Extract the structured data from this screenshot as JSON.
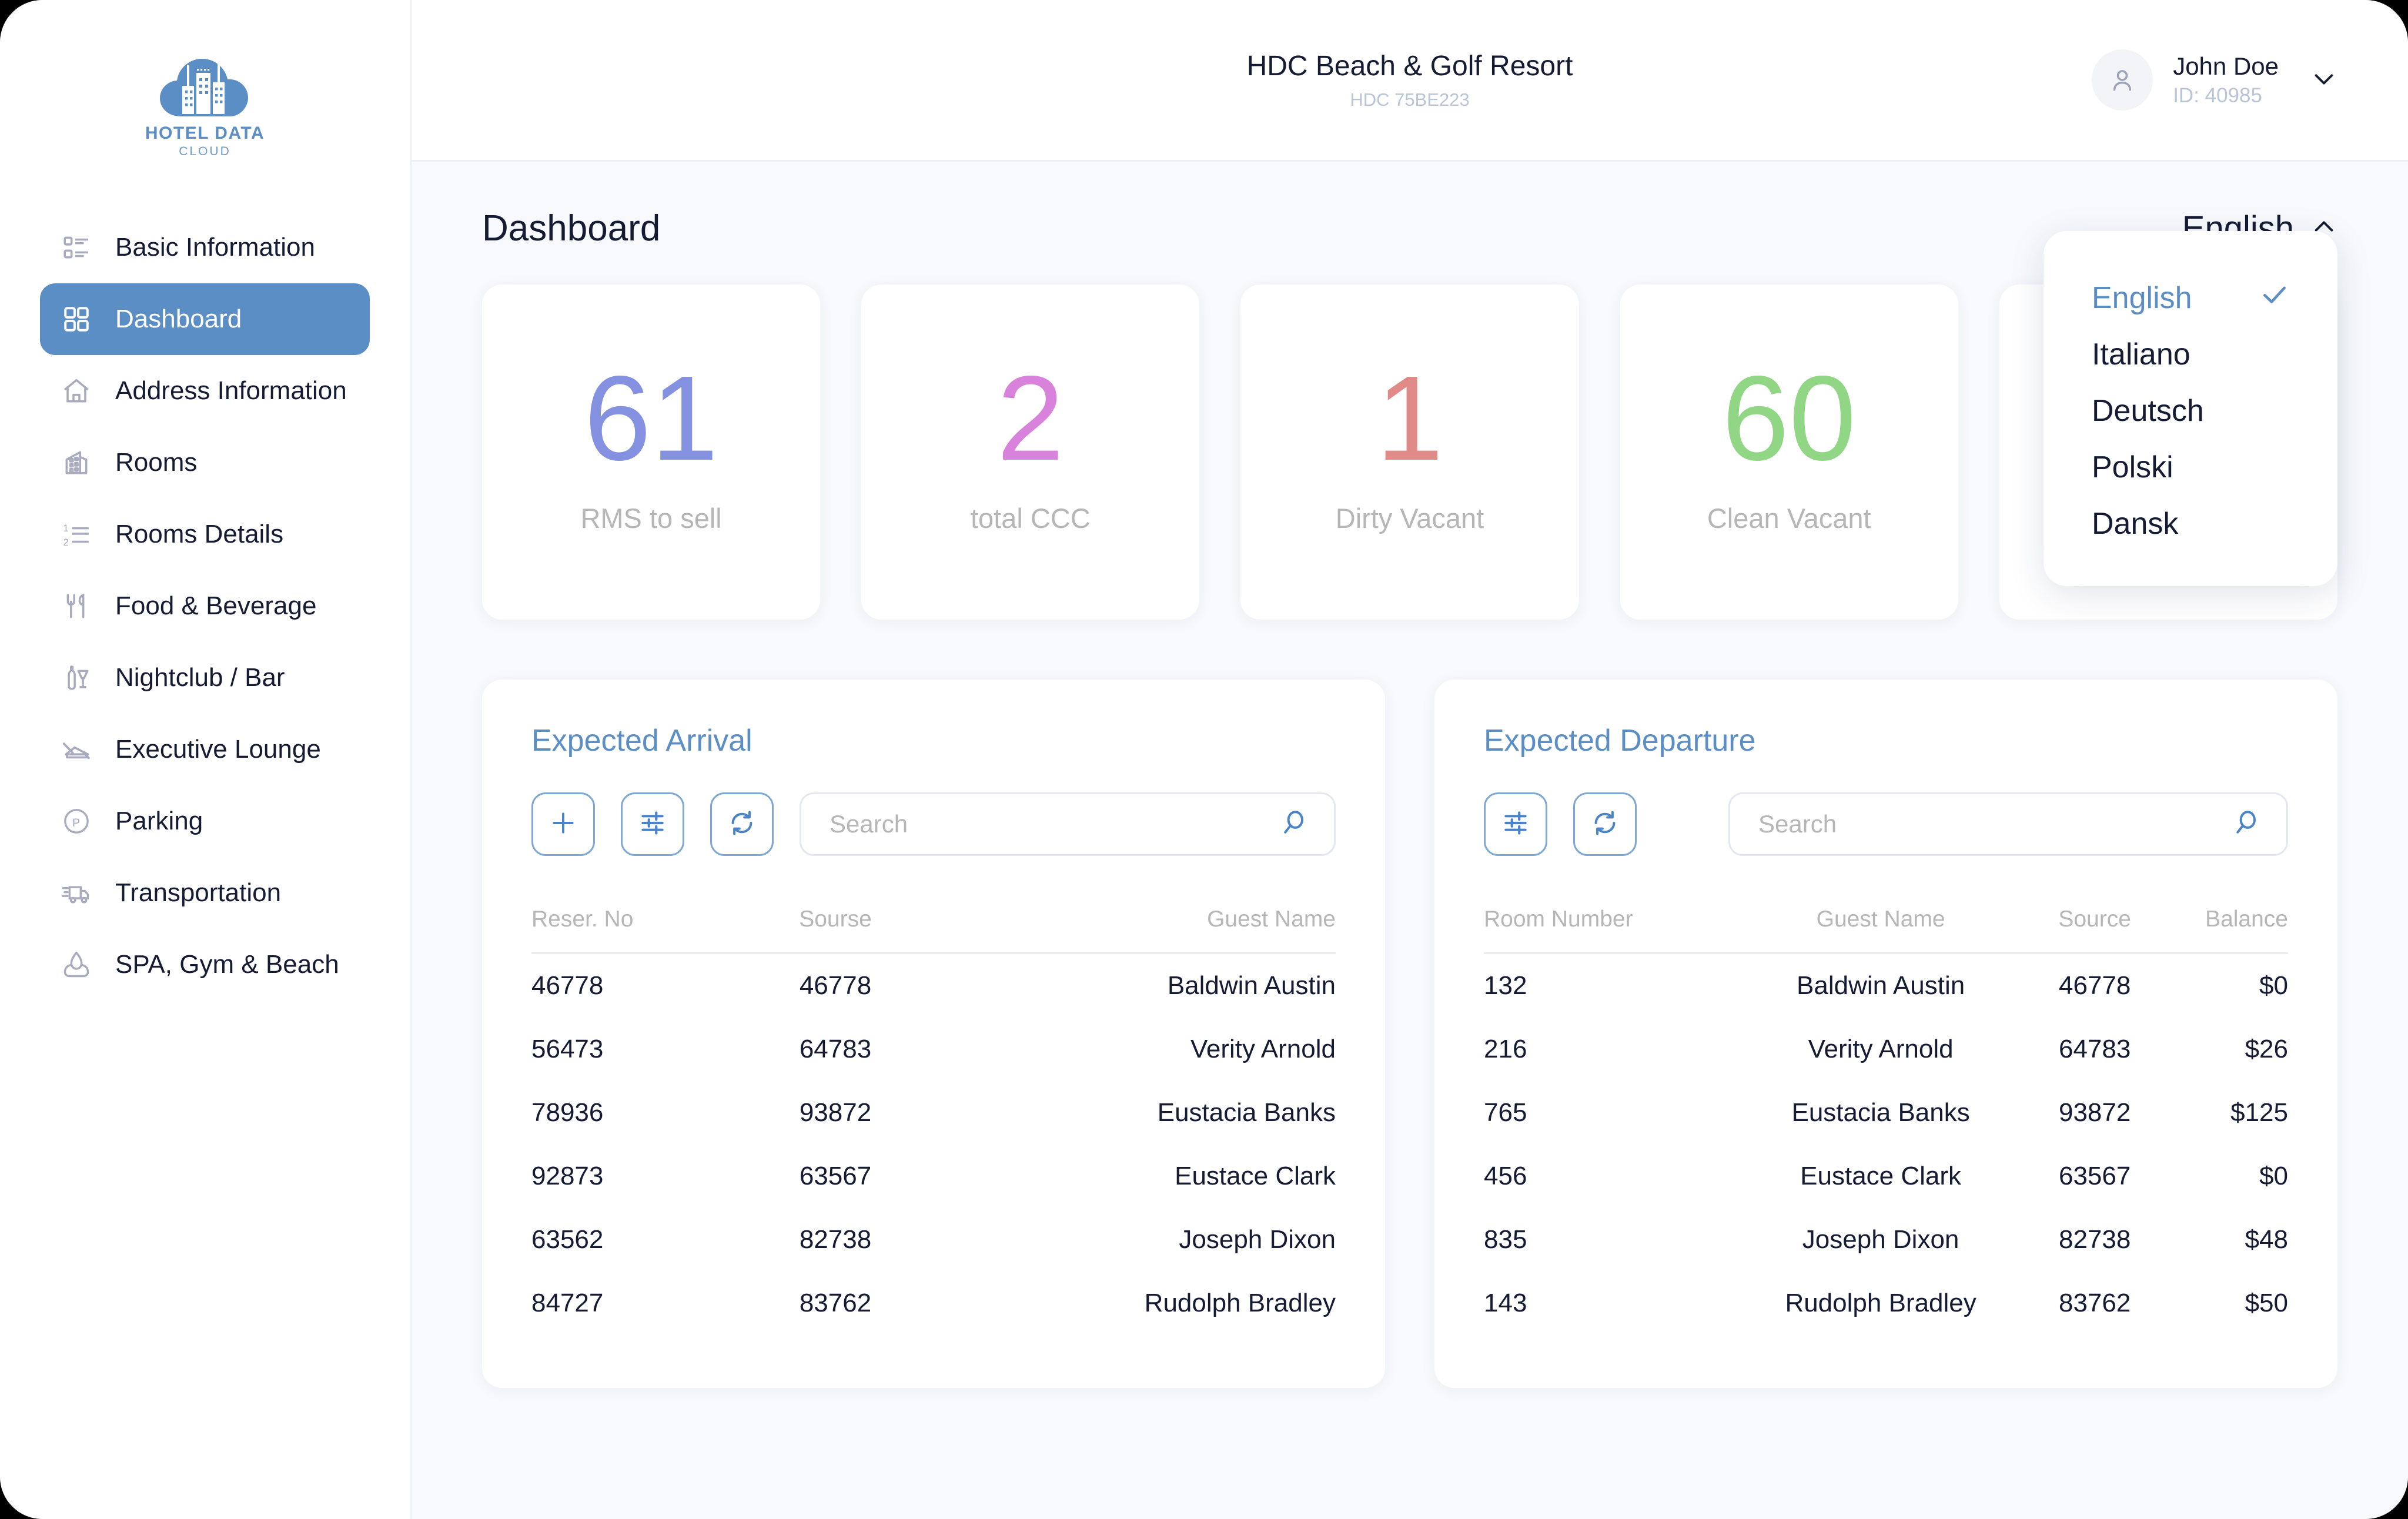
{
  "brand": {
    "logo_title": "HOTEL DATA",
    "logo_subtitle": "CLOUD",
    "accent_color": "#5b8ec4"
  },
  "sidebar": {
    "items": [
      {
        "label": "Basic Information",
        "icon": "list-detail-icon",
        "active": false
      },
      {
        "label": "Dashboard",
        "icon": "grid-icon",
        "active": true
      },
      {
        "label": "Address Information",
        "icon": "home-icon",
        "active": false
      },
      {
        "label": "Rooms",
        "icon": "building-icon",
        "active": false
      },
      {
        "label": "Rooms Details",
        "icon": "numbered-list-icon",
        "active": false
      },
      {
        "label": "Food & Beverage",
        "icon": "fork-knife-icon",
        "active": false
      },
      {
        "label": "Nightclub / Bar",
        "icon": "bottle-glass-icon",
        "active": false
      },
      {
        "label": "Executive Lounge",
        "icon": "lounge-chair-icon",
        "active": false
      },
      {
        "label": "Parking",
        "icon": "parking-icon",
        "active": false
      },
      {
        "label": "Transportation",
        "icon": "truck-icon",
        "active": false
      },
      {
        "label": "SPA, Gym & Beach",
        "icon": "spa-leaf-icon",
        "active": false
      }
    ]
  },
  "topbar": {
    "hotel_name": "HDC Beach & Golf Resort",
    "hotel_code": "HDC 75BE223",
    "user_name": "John Doe",
    "user_id": "ID: 40985"
  },
  "page": {
    "title": "Dashboard"
  },
  "language": {
    "current": "English",
    "options": [
      {
        "label": "English",
        "selected": true
      },
      {
        "label": "Italiano",
        "selected": false
      },
      {
        "label": "Deutsch",
        "selected": false
      },
      {
        "label": "Polski",
        "selected": false
      },
      {
        "label": "Dansk",
        "selected": false
      }
    ]
  },
  "stats": [
    {
      "value": "61",
      "label": "RMS to sell",
      "color": "#8490e0"
    },
    {
      "value": "2",
      "label": "total CCC",
      "color": "#d982db"
    },
    {
      "value": "1",
      "label": "Dirty Vacant",
      "color": "#e08b87"
    },
    {
      "value": "60",
      "label": "Clean Vacant",
      "color": "#90d684"
    },
    {
      "value": "",
      "label": "",
      "color": "#ffffff"
    }
  ],
  "arrival": {
    "title": "Expected Arrival",
    "tools": [
      "plus-icon",
      "filter-sliders-icon",
      "refresh-icon"
    ],
    "search_placeholder": "Search",
    "columns": [
      "Reser. No",
      "Sourse",
      "Guest Name"
    ],
    "rows": [
      [
        "46778",
        "46778",
        "Baldwin Austin"
      ],
      [
        "56473",
        "64783",
        "Verity Arnold"
      ],
      [
        "78936",
        "93872",
        "Eustacia Banks"
      ],
      [
        "92873",
        "63567",
        "Eustace Clark"
      ],
      [
        "63562",
        "82738",
        "Joseph Dixon"
      ],
      [
        "84727",
        "83762",
        "Rudolph Bradley"
      ]
    ]
  },
  "departure": {
    "title": "Expected Departure",
    "tools": [
      "filter-sliders-icon",
      "refresh-icon"
    ],
    "search_placeholder": "Search",
    "columns": [
      "Room Number",
      "Guest Name",
      "Source",
      "Balance"
    ],
    "rows": [
      [
        "132",
        "Baldwin Austin",
        "46778",
        "$0"
      ],
      [
        "216",
        "Verity Arnold",
        "64783",
        "$26"
      ],
      [
        "765",
        "Eustacia Banks",
        "93872",
        "$125"
      ],
      [
        "456",
        "Eustace Clark",
        "63567",
        "$0"
      ],
      [
        "835",
        "Joseph Dixon",
        "82738",
        "$48"
      ],
      [
        "143",
        "Rudolph Bradley",
        "83762",
        "$50"
      ]
    ]
  }
}
